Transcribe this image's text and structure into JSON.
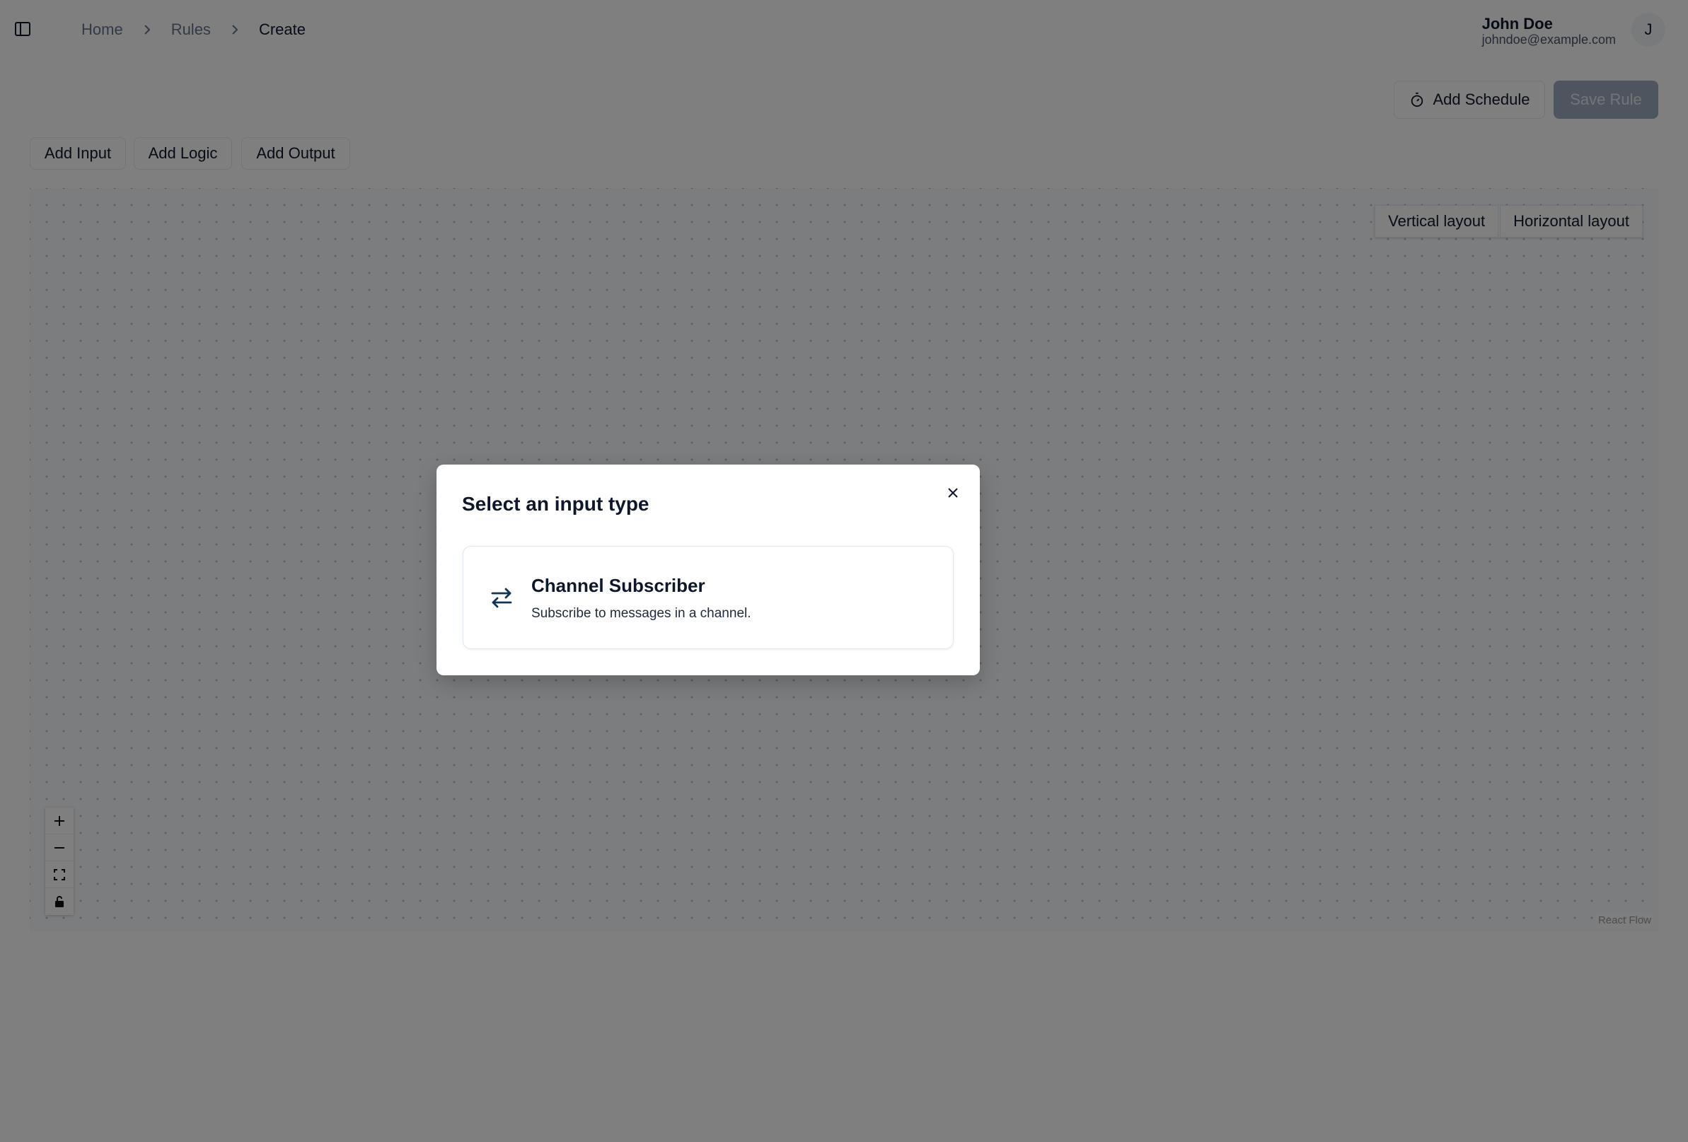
{
  "header": {
    "breadcrumb": [
      {
        "label": "Home"
      },
      {
        "label": "Rules"
      },
      {
        "label": "Create"
      }
    ],
    "user": {
      "name": "John Doe",
      "email": "johndoe@example.com",
      "avatar_initial": "J"
    }
  },
  "toolbar": {
    "add_schedule_label": "Add Schedule",
    "save_rule_label": "Save Rule",
    "add_input_label": "Add Input",
    "add_logic_label": "Add Logic",
    "add_output_label": "Add Output"
  },
  "canvas": {
    "vertical_layout_label": "Vertical layout",
    "horizontal_layout_label": "Horizontal layout",
    "attribution": "React Flow",
    "controls": [
      "plus-icon",
      "minus-icon",
      "fit-view-icon",
      "lock-icon"
    ]
  },
  "dialog": {
    "title": "Select an input type",
    "options": [
      {
        "title": "Channel Subscriber",
        "description": "Subscribe to messages in a channel.",
        "icon": "arrows-left-right-icon"
      }
    ]
  },
  "colors": {
    "save_button_bg": "#94a3b8",
    "overlay": "rgba(0,0,0,0.5)",
    "text_primary": "#0f172a",
    "text_muted": "#64748b"
  }
}
